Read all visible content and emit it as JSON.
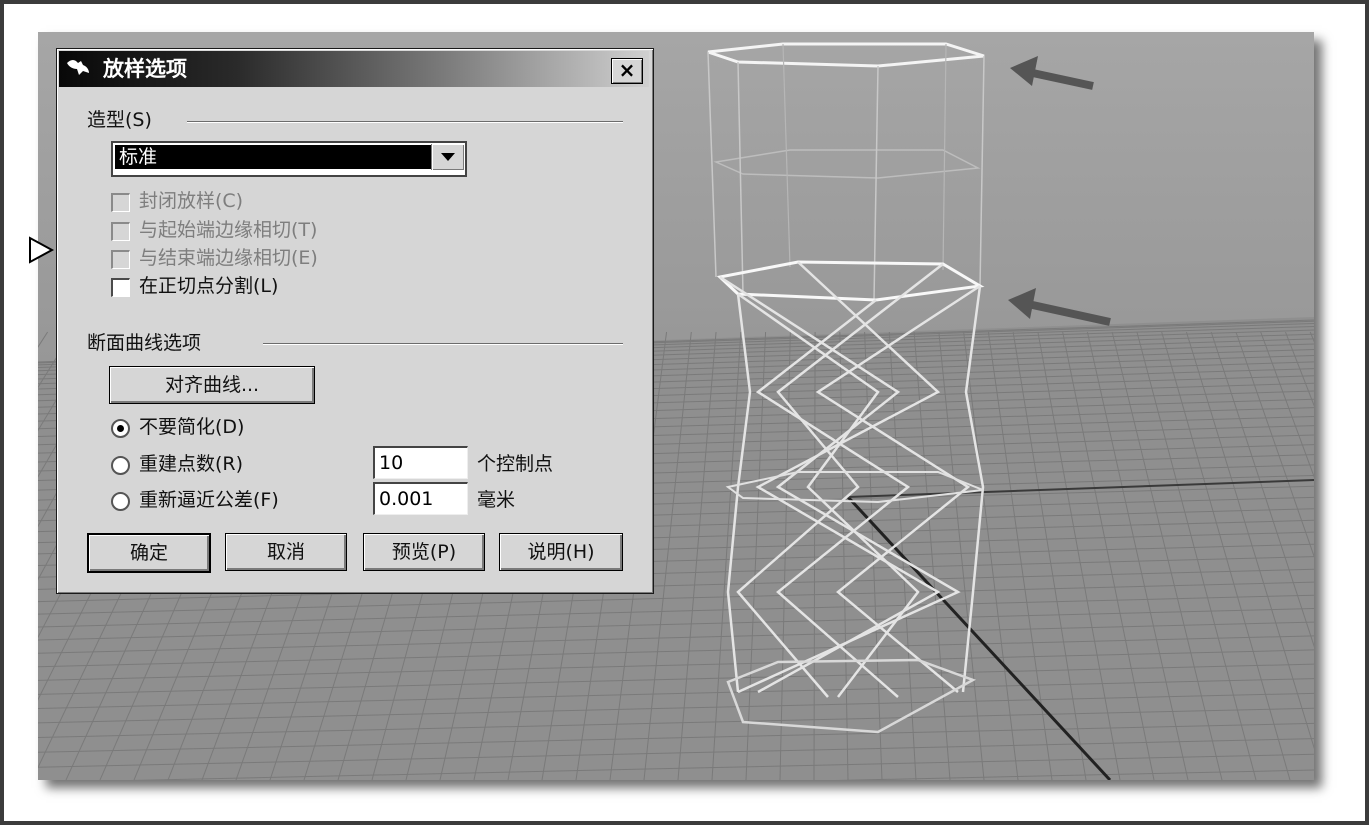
{
  "dialog": {
    "title": "放样选项",
    "close_label": "×",
    "style_section": "造型(S)",
    "style_select": {
      "value": "标准"
    },
    "checkboxes": [
      {
        "label": "封闭放样(C)",
        "checked": false,
        "enabled": false
      },
      {
        "label": "与起始端边缘相切(T)",
        "checked": false,
        "enabled": false
      },
      {
        "label": "与结束端边缘相切(E)",
        "checked": false,
        "enabled": false
      },
      {
        "label": "在正切点分割(L)",
        "checked": false,
        "enabled": true
      }
    ],
    "section_section": "断面曲线选项",
    "align_button": "对齐曲线...",
    "radios": [
      {
        "label": "不要简化(D)",
        "selected": true
      },
      {
        "label": "重建点数(R)",
        "selected": false
      },
      {
        "label": "重新逼近公差(F)",
        "selected": false
      }
    ],
    "rebuild": {
      "value": "10",
      "unit": "个控制点"
    },
    "refit": {
      "value": "0.001",
      "unit": "毫米"
    },
    "buttons": {
      "ok": "确定",
      "cancel": "取消",
      "preview": "预览(P)",
      "help": "说明(H)"
    }
  },
  "icons": {
    "title": "rhino-icon",
    "pointer": "mouse-pointer-icon",
    "annotation": "arrow-icon"
  },
  "colors": {
    "viewport_bg": "#9c9c9c",
    "grid": "#7e7e7e",
    "wireframe": "#e6e6e6",
    "arrow": "#555555"
  }
}
